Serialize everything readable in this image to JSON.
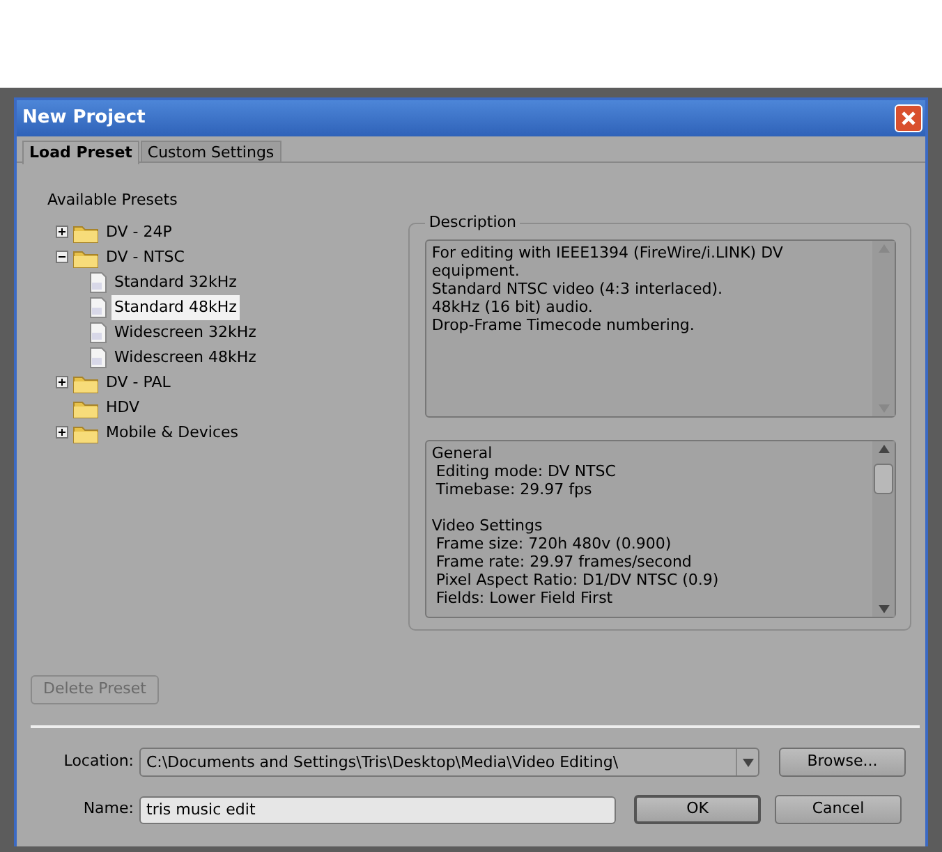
{
  "window": {
    "title": "New Project"
  },
  "tabs": [
    {
      "label": "Load Preset",
      "selected": true
    },
    {
      "label": "Custom Settings",
      "selected": false
    }
  ],
  "presets": {
    "label": "Available Presets",
    "tree": [
      {
        "kind": "folder",
        "label": "DV - 24P",
        "expanded": false,
        "selected": false
      },
      {
        "kind": "folder",
        "label": "DV - NTSC",
        "expanded": true,
        "selected": false,
        "children": [
          {
            "kind": "file",
            "label": "Standard 32kHz",
            "selected": false
          },
          {
            "kind": "file",
            "label": "Standard 48kHz",
            "selected": true
          },
          {
            "kind": "file",
            "label": "Widescreen 32kHz",
            "selected": false
          },
          {
            "kind": "file",
            "label": "Widescreen 48kHz",
            "selected": false
          }
        ]
      },
      {
        "kind": "folder",
        "label": "DV - PAL",
        "expanded": false,
        "selected": false
      },
      {
        "kind": "folder",
        "label": "HDV",
        "selected": false
      },
      {
        "kind": "folder",
        "label": "Mobile & Devices",
        "expanded": false,
        "selected": false
      }
    ]
  },
  "description": {
    "legend": "Description",
    "lines": [
      "For editing with IEEE1394 (FireWire/i.LINK) DV equipment.",
      "Standard NTSC video (4:3 interlaced).",
      "48kHz (16 bit) audio.",
      "Drop-Frame Timecode numbering."
    ],
    "settings": [
      {
        "heading": "General",
        "lines": [
          "Editing mode: DV NTSC",
          "Timebase: 29.97 fps"
        ]
      },
      {
        "heading": "Video Settings",
        "lines": [
          "Frame size: 720h 480v (0.900)",
          "Frame rate: 29.97 frames/second",
          "Pixel Aspect Ratio: D1/DV NTSC (0.9)",
          "Fields: Lower Field First"
        ]
      }
    ]
  },
  "delete_button": {
    "label": "Delete Preset",
    "disabled": true
  },
  "location": {
    "label": "Location:",
    "value": "C:\\Documents and Settings\\Tris\\Desktop\\Media\\Video Editing\\",
    "button": "Browse..."
  },
  "name": {
    "label": "Name:",
    "value": "tris music edit"
  },
  "buttons": [
    {
      "label": "OK",
      "default": true
    },
    {
      "label": "Cancel",
      "default": false
    }
  ]
}
